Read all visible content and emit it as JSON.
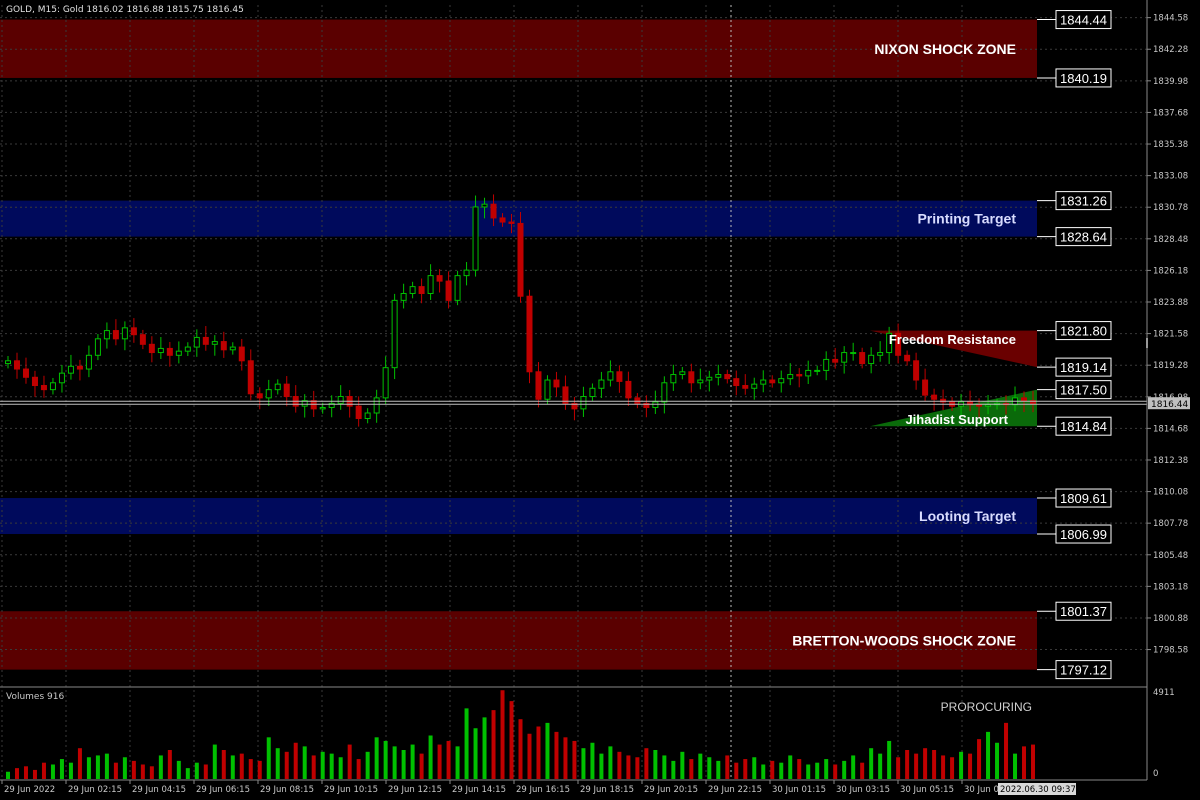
{
  "header": {
    "symbol_info": "GOLD, M15:  Gold  1816.02 1816.88 1815.75 1816.45"
  },
  "colors": {
    "background": "#000000",
    "grid": "#3a3a3a",
    "shock_zone": "#5a0000",
    "target_zone": "#000a5c",
    "bull": "#00c000",
    "bear": "#c00000",
    "resistance": "#6a0000",
    "support": "#0a6a0a"
  },
  "price_axis": {
    "min": 1796.0,
    "max": 1845.5,
    "ticks": [
      "1844.58",
      "1842.28",
      "1839.98",
      "1837.68",
      "1835.38",
      "1833.08",
      "1830.78",
      "1828.48",
      "1826.18",
      "1823.88",
      "1821.58",
      "1819.28",
      "1816.98",
      "1814.68",
      "1812.38",
      "1810.08",
      "1807.78",
      "1805.48",
      "1803.18",
      "1800.88",
      "1798.58"
    ],
    "current_price": "1816.44"
  },
  "volume_axis": {
    "title": "Volumes 916",
    "max_label": "4911",
    "min_label": "0",
    "max": 4911
  },
  "time_axis": {
    "labels": [
      "29 Jun 2022",
      "29 Jun 02:15",
      "29 Jun 04:15",
      "29 Jun 06:15",
      "29 Jun 08:15",
      "29 Jun 10:15",
      "29 Jun 12:15",
      "29 Jun 14:15",
      "29 Jun 16:15",
      "29 Jun 18:15",
      "29 Jun 20:15",
      "29 Jun 22:15",
      "30 Jun 01:15",
      "30 Jun 03:15",
      "30 Jun 05:15",
      "30 Jun 0"
    ],
    "cursor_label": "2022.06.30 09:37"
  },
  "zones": [
    {
      "name": "NIXON SHOCK ZONE",
      "top": "1844.44",
      "bottom": "1840.19",
      "kind": "shock"
    },
    {
      "name": "Printing Target",
      "top": "1831.26",
      "bottom": "1828.64",
      "kind": "target"
    },
    {
      "name": "Looting Target",
      "top": "1809.61",
      "bottom": "1806.99",
      "kind": "target"
    },
    {
      "name": "BRETTON-WOODS SHOCK ZONE",
      "top": "1801.37",
      "bottom": "1797.12",
      "kind": "shock"
    }
  ],
  "resistance": {
    "label": "Freedom Resistance",
    "top": "1821.80",
    "bottom": "1819.14"
  },
  "support": {
    "label": "Jihadist Support",
    "top": "1817.50",
    "bottom": "1814.84"
  },
  "watermark": "PROROCURING",
  "chart_data": {
    "type": "candlestick",
    "open": [
      1819.4,
      1819.6,
      1819.0,
      1818.4,
      1817.8,
      1817.5,
      1818.0,
      1818.7,
      1819.2,
      1819.0,
      1820.0,
      1821.2,
      1821.8,
      1821.2,
      1822.0,
      1821.5,
      1820.8,
      1820.2,
      1820.5,
      1820.0,
      1820.3,
      1820.6,
      1821.3,
      1820.8,
      1821.0,
      1820.4,
      1820.6,
      1819.6,
      1817.2,
      1816.9,
      1817.5,
      1817.9,
      1817.0,
      1816.3,
      1816.7,
      1816.1,
      1816.2,
      1816.5,
      1817.0,
      1816.3,
      1815.4,
      1815.8,
      1816.9,
      1819.1,
      1824.0,
      1824.5,
      1825.0,
      1824.5,
      1825.8,
      1825.4,
      1824.0,
      1825.8,
      1826.2,
      1830.8,
      1831.0,
      1830.0,
      1829.7,
      1829.6,
      1824.3,
      1818.8,
      1816.8,
      1818.2,
      1817.7,
      1816.5,
      1816.1,
      1817.0,
      1817.6,
      1818.2,
      1818.8,
      1818.1,
      1816.9,
      1816.5,
      1816.2,
      1816.6,
      1818.0,
      1818.6,
      1818.8,
      1818.0,
      1818.2,
      1818.4,
      1818.6,
      1818.3,
      1817.8,
      1817.6,
      1817.9,
      1818.2,
      1818.0,
      1818.3,
      1818.6,
      1818.5,
      1818.9,
      1818.9,
      1819.7,
      1819.5,
      1820.2,
      1820.2,
      1819.4,
      1820.0,
      1820.2,
      1821.6,
      1820.0,
      1819.6,
      1818.2,
      1817.1,
      1816.8,
      1816.6,
      1816.3,
      1816.6,
      1816.4,
      1816.3,
      1816.4,
      1816.5,
      1816.4,
      1816.9,
      1816.7
    ],
    "close": [
      1819.6,
      1819.0,
      1818.4,
      1817.8,
      1817.5,
      1818.0,
      1818.7,
      1819.2,
      1819.0,
      1820.0,
      1821.2,
      1821.8,
      1821.2,
      1822.0,
      1821.5,
      1820.8,
      1820.2,
      1820.5,
      1820.0,
      1820.3,
      1820.6,
      1821.3,
      1820.8,
      1821.0,
      1820.4,
      1820.6,
      1819.6,
      1817.2,
      1816.9,
      1817.5,
      1817.9,
      1817.0,
      1816.3,
      1816.7,
      1816.1,
      1816.2,
      1816.5,
      1817.0,
      1816.3,
      1815.4,
      1815.8,
      1816.9,
      1819.1,
      1824.0,
      1824.5,
      1825.0,
      1824.5,
      1825.8,
      1825.4,
      1824.0,
      1825.8,
      1826.2,
      1830.8,
      1831.0,
      1830.0,
      1829.7,
      1829.6,
      1824.3,
      1818.8,
      1816.8,
      1818.2,
      1817.7,
      1816.5,
      1816.1,
      1817.0,
      1817.6,
      1818.2,
      1818.8,
      1818.1,
      1816.9,
      1816.5,
      1816.2,
      1816.6,
      1818.0,
      1818.6,
      1818.8,
      1818.0,
      1818.2,
      1818.4,
      1818.6,
      1818.3,
      1817.8,
      1817.6,
      1817.9,
      1818.2,
      1818.0,
      1818.3,
      1818.6,
      1818.5,
      1818.9,
      1818.9,
      1819.7,
      1819.5,
      1820.2,
      1820.2,
      1819.4,
      1820.0,
      1820.2,
      1821.6,
      1820.0,
      1819.6,
      1818.2,
      1817.1,
      1816.8,
      1816.6,
      1816.3,
      1816.6,
      1816.4,
      1816.3,
      1816.4,
      1816.5,
      1816.4,
      1816.9,
      1816.7,
      1816.45
    ],
    "volume": [
      400,
      600,
      700,
      500,
      900,
      800,
      1100,
      900,
      1700,
      1200,
      1300,
      1400,
      900,
      1200,
      1000,
      800,
      700,
      1300,
      1600,
      1000,
      600,
      900,
      800,
      1900,
      1600,
      1300,
      1400,
      1100,
      1000,
      2300,
      1700,
      1500,
      2000,
      1800,
      1300,
      1500,
      1400,
      1200,
      1900,
      1100,
      1500,
      2300,
      2100,
      1800,
      1600,
      1900,
      1400,
      2400,
      1900,
      2100,
      1800,
      3900,
      2800,
      3400,
      3800,
      4900,
      4300,
      3300,
      2500,
      2900,
      3100,
      2600,
      2300,
      2100,
      1700,
      2000,
      1400,
      1800,
      1500,
      1300,
      1200,
      1700,
      1600,
      1300,
      1000,
      1500,
      1100,
      1400,
      1200,
      1000,
      1300,
      900,
      1100,
      1200,
      800,
      1000,
      900,
      1300,
      1100,
      800,
      900,
      1100,
      800,
      1000,
      1300,
      900,
      1700,
      1400,
      2100,
      1200,
      1600,
      1400,
      1700,
      1600,
      1300,
      1200,
      1500,
      1400,
      2200,
      2600,
      2000,
      3100,
      1400,
      1800,
      1900
    ]
  }
}
